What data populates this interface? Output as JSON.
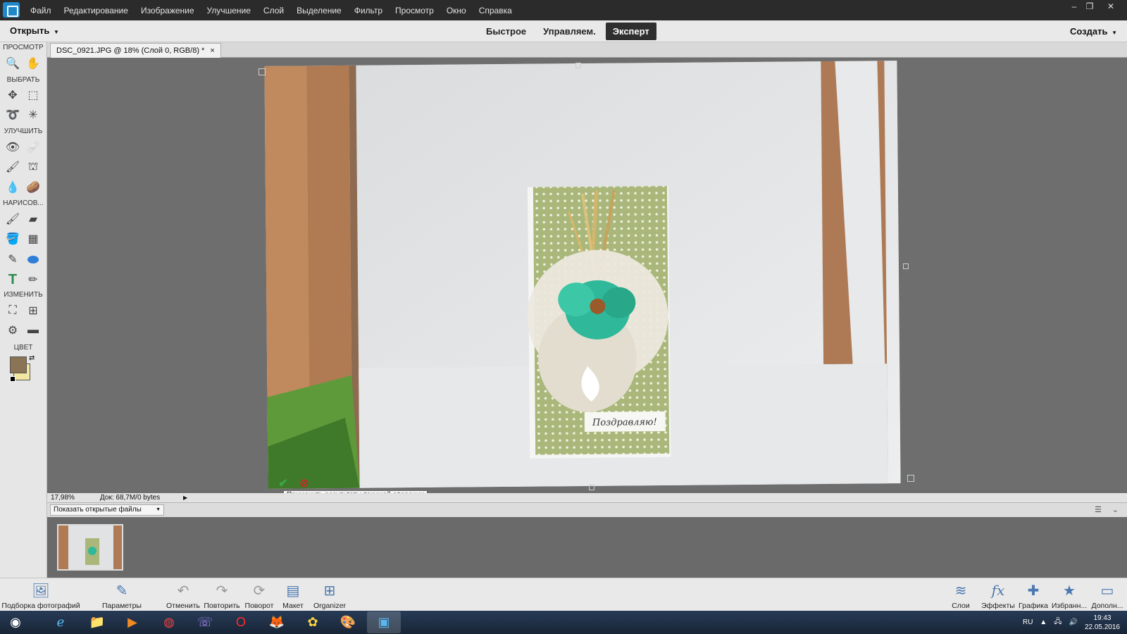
{
  "menu": [
    "Файл",
    "Редактирование",
    "Изображение",
    "Улучшение",
    "Слой",
    "Выделение",
    "Фильтр",
    "Просмотр",
    "Окно",
    "Справка"
  ],
  "window_controls": {
    "minimize": "–",
    "restore": "❐",
    "close": "✕"
  },
  "topbar": {
    "open_label": "Открыть",
    "modes": [
      "Быстрое",
      "Управляем.",
      "Эксперт"
    ],
    "active_mode": "Эксперт",
    "create_label": "Создать"
  },
  "toolbox": {
    "sections": [
      "ПРОСМОТР",
      "ВЫБРАТЬ",
      "УЛУЧШИТЬ",
      "НАРИСОВ...",
      "ИЗМЕНИТЬ",
      "ЦВЕТ"
    ],
    "foreground_color": "#8b7355",
    "background_color": "#f2e6a0"
  },
  "document": {
    "tab_title": "DSC_0921.JPG @ 18% (Слой 0, RGB/8) *",
    "tab_close": "×"
  },
  "status": {
    "zoom": "17,98%",
    "doc_info": "Док: 68,7M/0 bytes"
  },
  "commit": {
    "tooltip": "Применить результаты текущей операции",
    "apply_icon": "✔",
    "cancel_icon": "⃠"
  },
  "bin": {
    "select_label": "Показать открытые файлы"
  },
  "bottom": {
    "left": [
      {
        "label": "Подборка фотографий",
        "icon": "photo-bin-icon"
      },
      {
        "label": "Параметры инструмента",
        "icon": "tool-options-icon"
      },
      {
        "label": "Отменить",
        "icon": "undo-icon"
      },
      {
        "label": "Повторить",
        "icon": "redo-icon"
      },
      {
        "label": "Поворот",
        "icon": "rotate-icon"
      },
      {
        "label": "Макет",
        "icon": "layout-icon"
      },
      {
        "label": "Organizer",
        "icon": "organizer-icon"
      }
    ],
    "right": [
      {
        "label": "Слои",
        "icon": "layers-icon"
      },
      {
        "label": "Эффекты",
        "icon": "effects-icon"
      },
      {
        "label": "Графика",
        "icon": "graphics-icon"
      },
      {
        "label": "Избранн...",
        "icon": "favorites-icon"
      },
      {
        "label": "Дополн...",
        "icon": "more-icon"
      }
    ]
  },
  "taskbar": {
    "lang": "RU",
    "time": "19:43",
    "date": "22.05.2016"
  },
  "card_text": "Поздравляю!"
}
